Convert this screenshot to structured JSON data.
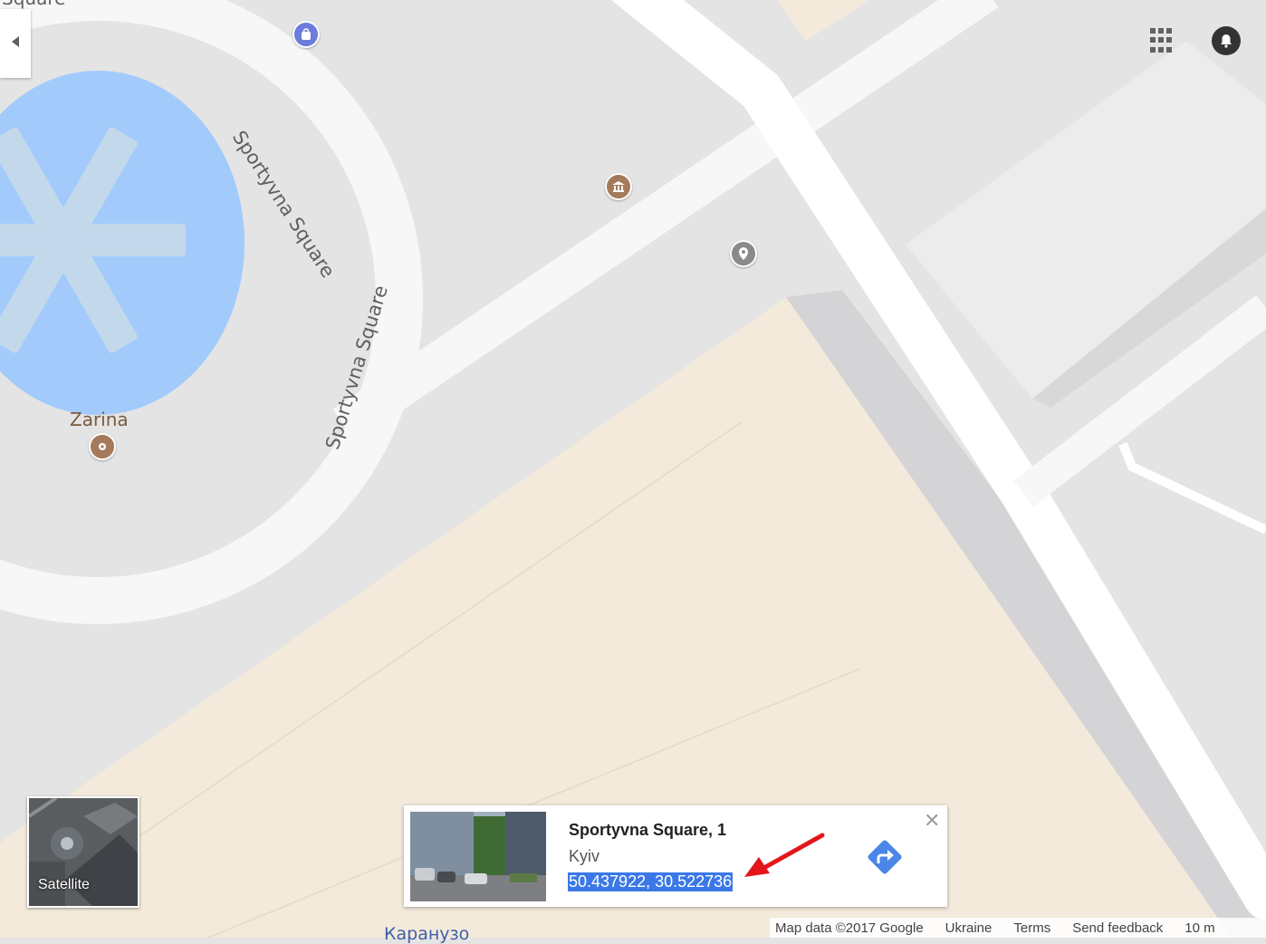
{
  "map": {
    "colors": {
      "base": "#e4e4e4",
      "road": "#f7f7f7",
      "water": "#a2cbfc",
      "land": "#f3eadb",
      "building": "#ececec"
    },
    "street_label_1": "Sportyvna Square",
    "street_label_2": "Sportyvna Square",
    "top_cut_label": "Square",
    "bottom_cut_label": "Каранузо",
    "poi_name": "Zarina",
    "icons": [
      "shopping-bag-icon",
      "museum-icon",
      "pin-icon",
      "food-icon"
    ]
  },
  "toolbar": {
    "apps_icon": "grid-icon",
    "notifications_icon": "bell-icon",
    "collapse_icon": "triangle-left-icon"
  },
  "layer_toggle": {
    "label": "Satellite"
  },
  "place_card": {
    "title": "Sportyvna Square, 1",
    "city": "Kyiv",
    "coordinates": "50.437922, 30.522736",
    "close_icon": "close-icon",
    "directions_icon": "directions-icon",
    "highlight_color": "#3b78e7"
  },
  "footer": {
    "map_data": "Map data ©2017 Google",
    "region": "Ukraine",
    "terms": "Terms",
    "feedback": "Send feedback",
    "scale": "10 m"
  }
}
